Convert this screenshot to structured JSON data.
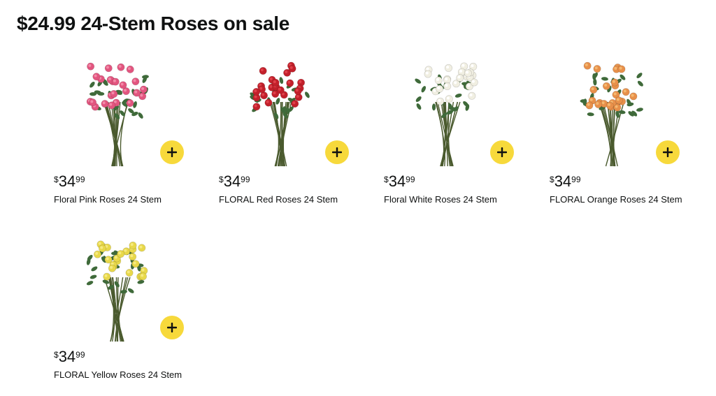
{
  "page": {
    "title": "$24.99 24-Stem Roses on sale"
  },
  "theme": {
    "add_button_color": "#f7d93b",
    "plus_color": "#0f1111",
    "stem_color": "#4a5a2e",
    "leaf_color": "#3f6a3a"
  },
  "products": [
    {
      "name": "Floral Pink Roses 24 Stem",
      "price_symbol": "$",
      "price_whole": "34",
      "price_fraction": "99",
      "flower_color": "#e2557f",
      "flower_highlight": "#f28aa8",
      "add_icon": "plus-icon"
    },
    {
      "name": "FLORAL Red Roses 24 Stem",
      "price_symbol": "$",
      "price_whole": "34",
      "price_fraction": "99",
      "flower_color": "#c2202b",
      "flower_highlight": "#e0404a",
      "add_icon": "plus-icon"
    },
    {
      "name": "Floral White Roses 24 Stem",
      "price_symbol": "$",
      "price_whole": "34",
      "price_fraction": "99",
      "flower_color": "#f1efe2",
      "flower_highlight": "#ffffff",
      "add_icon": "plus-icon"
    },
    {
      "name": "FLORAL Orange Roses 24 Stem",
      "price_symbol": "$",
      "price_whole": "34",
      "price_fraction": "99",
      "flower_color": "#e8904a",
      "flower_highlight": "#f4b870",
      "add_icon": "plus-icon"
    },
    {
      "name": "FLORAL Yellow Roses 24 Stem",
      "price_symbol": "$",
      "price_whole": "34",
      "price_fraction": "99",
      "flower_color": "#e8d84a",
      "flower_highlight": "#f6ea80",
      "add_icon": "plus-icon"
    }
  ]
}
